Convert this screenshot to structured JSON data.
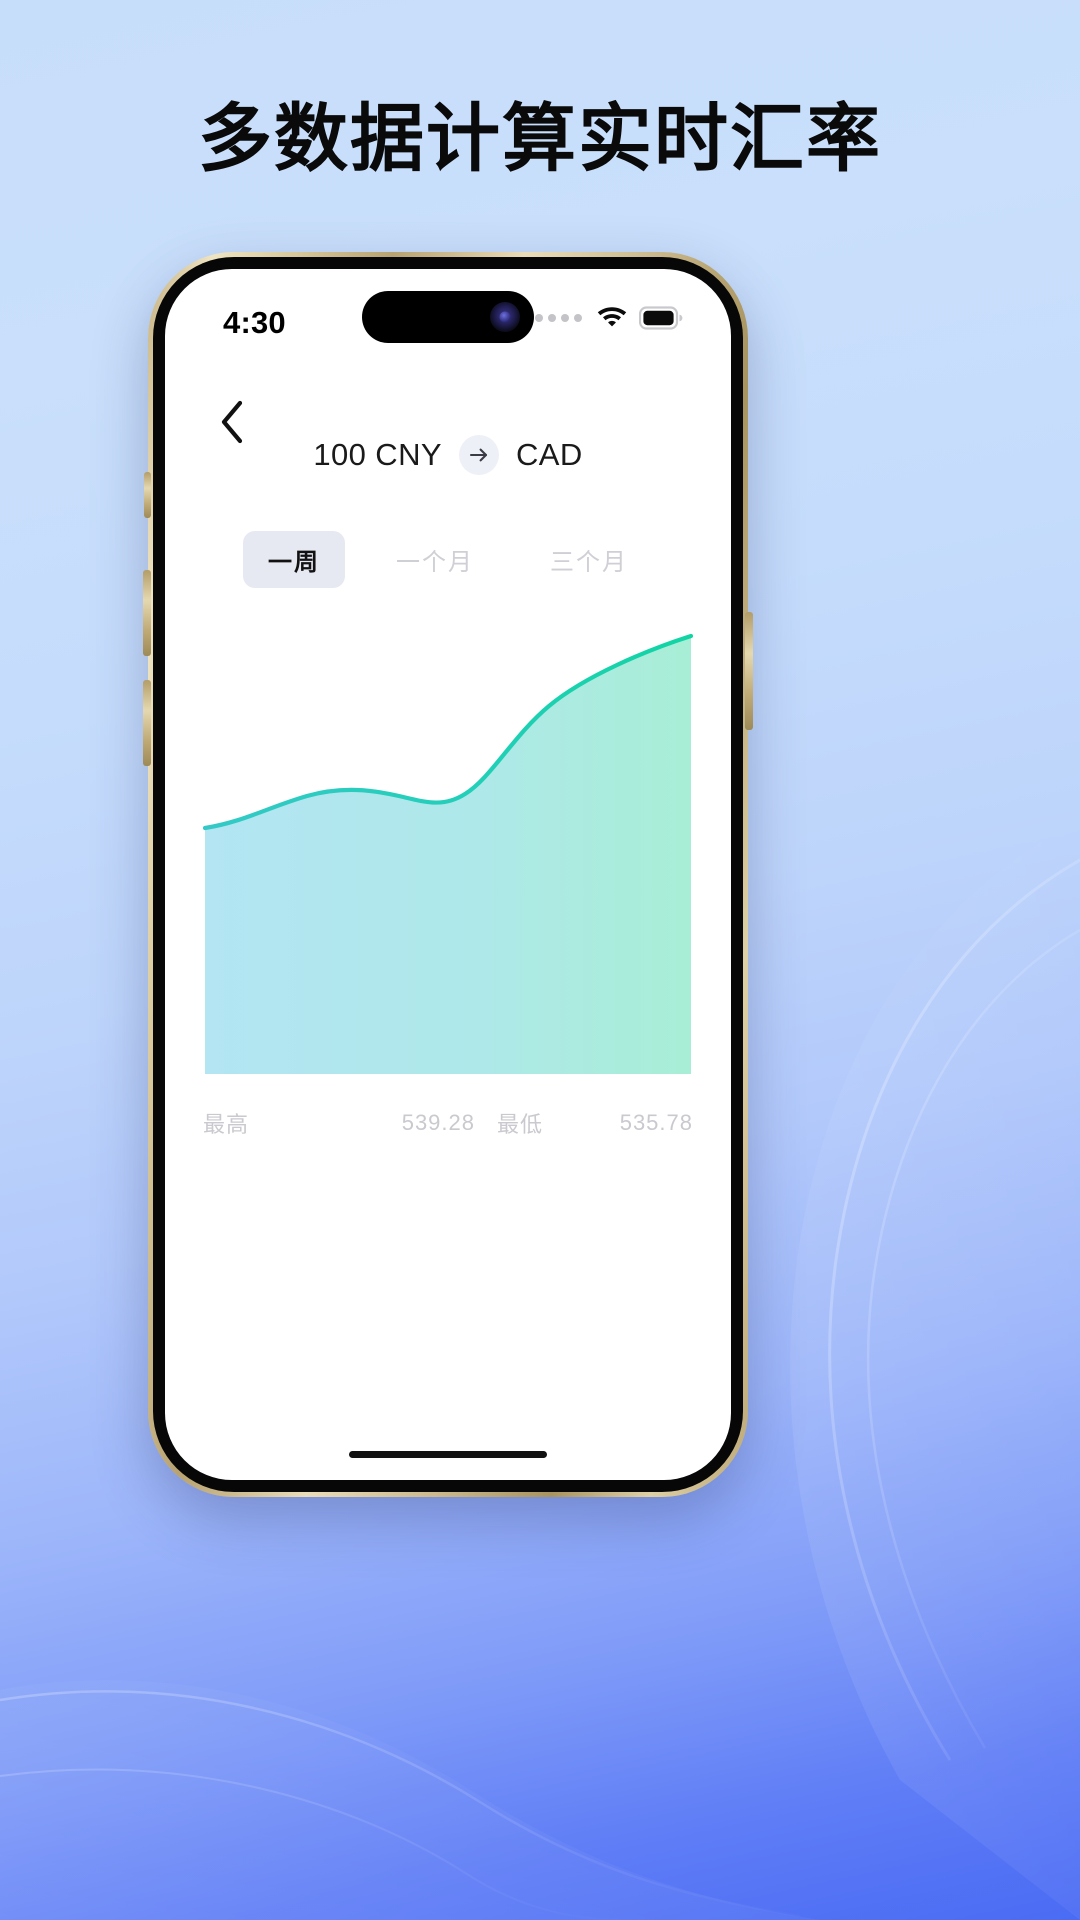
{
  "promo": {
    "headline": "多数据计算实时汇率"
  },
  "theme": {
    "bg_top": "#c7defb",
    "bg_bottom": "#4a6bf4",
    "accent_line": "#19cfae",
    "fill_left": "#b5e6f2",
    "fill_right": "#a9ecd9",
    "tab_active_bg": "#e6e8f2",
    "muted_text": "#c9c9cf",
    "phone_frame": "#d8c89b"
  },
  "status_bar": {
    "time": "4:30",
    "signal_icon": "signal-dots-icon",
    "wifi_icon": "wifi-icon",
    "battery_icon": "battery-full-icon",
    "battery_level": "100"
  },
  "app": {
    "back_icon": "chevron-left-icon",
    "pair": {
      "from": "100 CNY",
      "arrow_icon": "arrow-right-icon",
      "to": "CAD"
    },
    "period_tabs": [
      {
        "label": "一周",
        "active": true
      },
      {
        "label": "一个月",
        "active": false
      },
      {
        "label": "三个月",
        "active": false
      }
    ],
    "stats": {
      "high_label": "最高",
      "high_value": "539.28",
      "low_label": "最低",
      "low_value": "535.78"
    }
  },
  "chart_data": {
    "type": "area",
    "title": "",
    "xlabel": "",
    "ylabel": "",
    "grid": false,
    "legend": false,
    "series": [
      {
        "name": "100 CNY → CAD",
        "x": [
          0,
          1,
          2,
          3,
          4,
          5,
          6,
          7,
          8,
          9,
          10,
          11,
          12
        ],
        "values": [
          536.1,
          536.55,
          537.1,
          537.45,
          537.5,
          537.35,
          537.3,
          537.4,
          537.95,
          538.6,
          539.0,
          539.2,
          539.28
        ]
      }
    ],
    "ylim": [
      535.78,
      539.28
    ],
    "high": 539.28,
    "low": 535.78,
    "line_color": "#19cfae",
    "fill_gradient": [
      "#b5e6f2",
      "#a9ecd9"
    ]
  }
}
